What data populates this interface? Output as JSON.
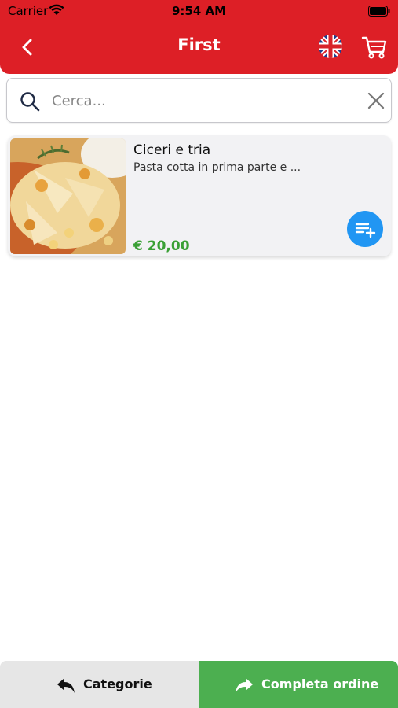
{
  "status_bar": {
    "carrier": "Carrier",
    "time": "9:54 AM"
  },
  "header": {
    "title": "First",
    "back_icon": "chevron-left-icon",
    "language_icon": "uk-flag-icon",
    "cart_icon": "cart-icon"
  },
  "search": {
    "placeholder": "Cerca..."
  },
  "products": [
    {
      "name": "Ciceri e tria",
      "description": "Pasta cotta in prima parte e ...",
      "price": "€ 20,00",
      "add_icon": "playlist-add-icon"
    }
  ],
  "footer": {
    "categories_label": "Categorie",
    "complete_label": "Completa ordine"
  },
  "colors": {
    "brand_red": "#dd1f26",
    "price_green": "#3aa035",
    "accent_blue": "#2196f3",
    "complete_green": "#4caf50"
  }
}
